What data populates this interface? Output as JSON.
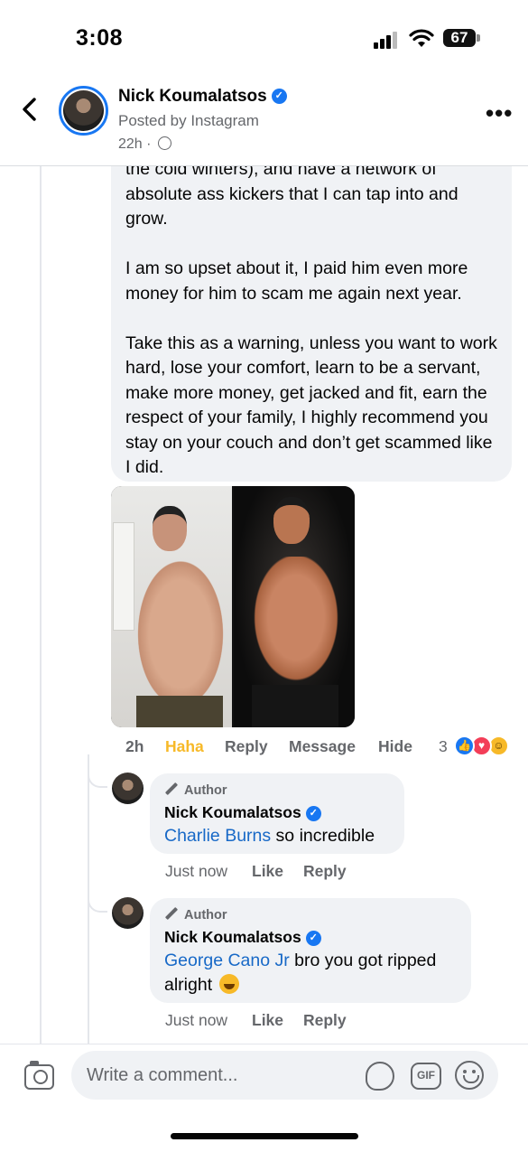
{
  "status_bar": {
    "time": "3:08",
    "battery": "67"
  },
  "header": {
    "name": "Nick Koumalatsos",
    "posted_by": "Posted by Instagram",
    "age": "22h",
    "separator": "·"
  },
  "main_comment": {
    "paragraphs": [
      "the cold winters), and have a network of absolute ass kickers that I can tap into and grow.",
      "I am so upset about it, I paid him even more money for him to scam me again next year.",
      "Take this as a warning, unless you want to work hard, lose your comfort, learn to be a servant, make more money, get jacked and fit, earn the respect of your family, I highly recommend you stay on your couch and don’t get scammed like I did."
    ],
    "actions": {
      "time": "2h",
      "reaction": "Haha",
      "reply": "Reply",
      "message": "Message",
      "hide": "Hide",
      "reaction_count": "3"
    },
    "reaction_icons": [
      "like-icon",
      "love-icon",
      "haha-icon"
    ]
  },
  "replies": [
    {
      "author_tag": "Author",
      "name": "Nick Koumalatsos",
      "mention": "Charlie Burns",
      "text": " so incredible",
      "time": "Just now",
      "like": "Like",
      "reply": "Reply"
    },
    {
      "author_tag": "Author",
      "name": "Nick Koumalatsos",
      "mention": "George Cano Jr",
      "text": " bro you got ripped alright",
      "time": "Just now",
      "like": "Like",
      "reply": "Reply"
    }
  ],
  "composer": {
    "placeholder": "Write a comment...",
    "gif_label": "GIF"
  },
  "colors": {
    "accent": "#1877f2",
    "mention": "#1869c7",
    "haha": "#f7b928",
    "bubble": "#f0f2f5",
    "muted": "#65676b"
  }
}
